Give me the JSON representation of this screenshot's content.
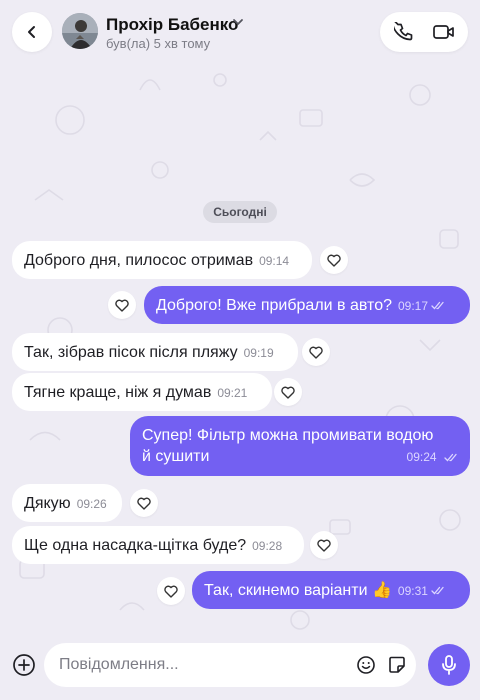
{
  "header": {
    "contact_name": "Прохір Бабенко",
    "status": "був(ла) 5 хв тому"
  },
  "chat": {
    "date_separator": "Сьогодні",
    "messages": [
      {
        "direction": "incoming",
        "text": "Доброго дня, пилосос отримав",
        "time": "09:14"
      },
      {
        "direction": "outgoing",
        "text": "Доброго! Вже прибрали в авто?",
        "time": "09:17",
        "read": true
      },
      {
        "direction": "incoming",
        "text": "Так, зібрав пісок після пляжу",
        "time": "09:19"
      },
      {
        "direction": "incoming",
        "text": "Тягне краще, ніж я думав",
        "time": "09:21"
      },
      {
        "direction": "outgoing",
        "text_line1": "Супер! Фільтр можна промивати водою",
        "text_line2": "й сушити",
        "time": "09:24",
        "read": true
      },
      {
        "direction": "incoming",
        "text": "Дякую",
        "time": "09:26"
      },
      {
        "direction": "incoming",
        "text": "Ще одна насадка-щітка буде?",
        "time": "09:28"
      },
      {
        "direction": "outgoing",
        "text": "Так, скинемо варіанти 👍",
        "time": "09:31",
        "read": true
      }
    ]
  },
  "composer": {
    "placeholder": "Повідомлення..."
  },
  "colors": {
    "accent": "#7360f2",
    "background": "#eeecf4",
    "incoming_bubble": "#ffffff"
  },
  "icons": [
    "back-chevron-icon",
    "avatar",
    "chevron-down-icon",
    "phone-icon",
    "video-camera-icon",
    "heart-icon",
    "double-check-icon",
    "plus-circle-icon",
    "emoji-icon",
    "sticker-icon",
    "microphone-icon"
  ]
}
